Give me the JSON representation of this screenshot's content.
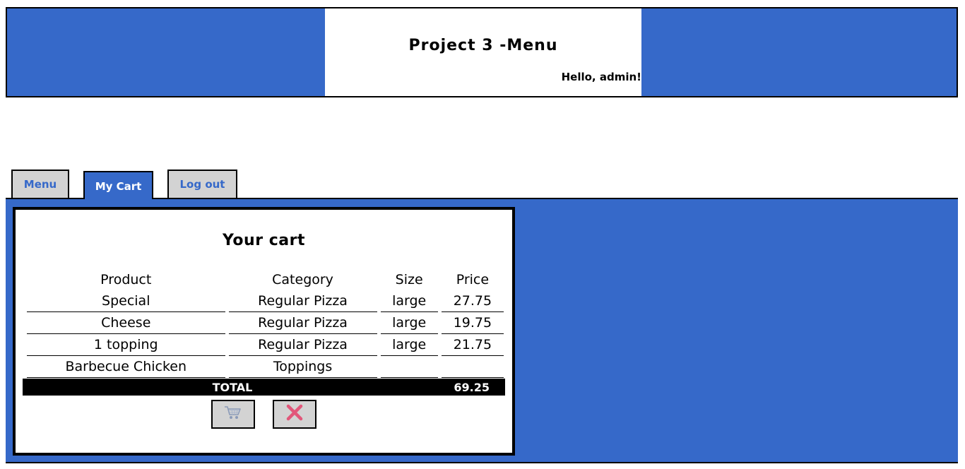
{
  "header": {
    "title": "Project 3 -Menu",
    "greeting": "Hello, admin!"
  },
  "tabs": [
    {
      "label": "Menu",
      "active": false
    },
    {
      "label": "My Cart",
      "active": true
    },
    {
      "label": "Log out",
      "active": false
    }
  ],
  "cart": {
    "title": "Your cart",
    "columns": [
      "Product",
      "Category",
      "Size",
      "Price"
    ],
    "rows": [
      {
        "product": "Special",
        "category": "Regular Pizza",
        "size": "large",
        "price": "27.75"
      },
      {
        "product": "Cheese",
        "category": "Regular Pizza",
        "size": "large",
        "price": "19.75"
      },
      {
        "product": "1 topping",
        "category": "Regular Pizza",
        "size": "large",
        "price": "21.75"
      },
      {
        "product": "Barbecue Chicken",
        "category": "Toppings",
        "size": "",
        "price": ""
      }
    ],
    "total_label": "TOTAL",
    "total_value": "69.25",
    "checkout_icon": "shopping-cart-icon",
    "clear_icon": "close-x-icon"
  },
  "colors": {
    "brand_blue": "#3669c9",
    "tab_inactive": "#d3d3d3",
    "clear_icon": "#e2567a"
  }
}
